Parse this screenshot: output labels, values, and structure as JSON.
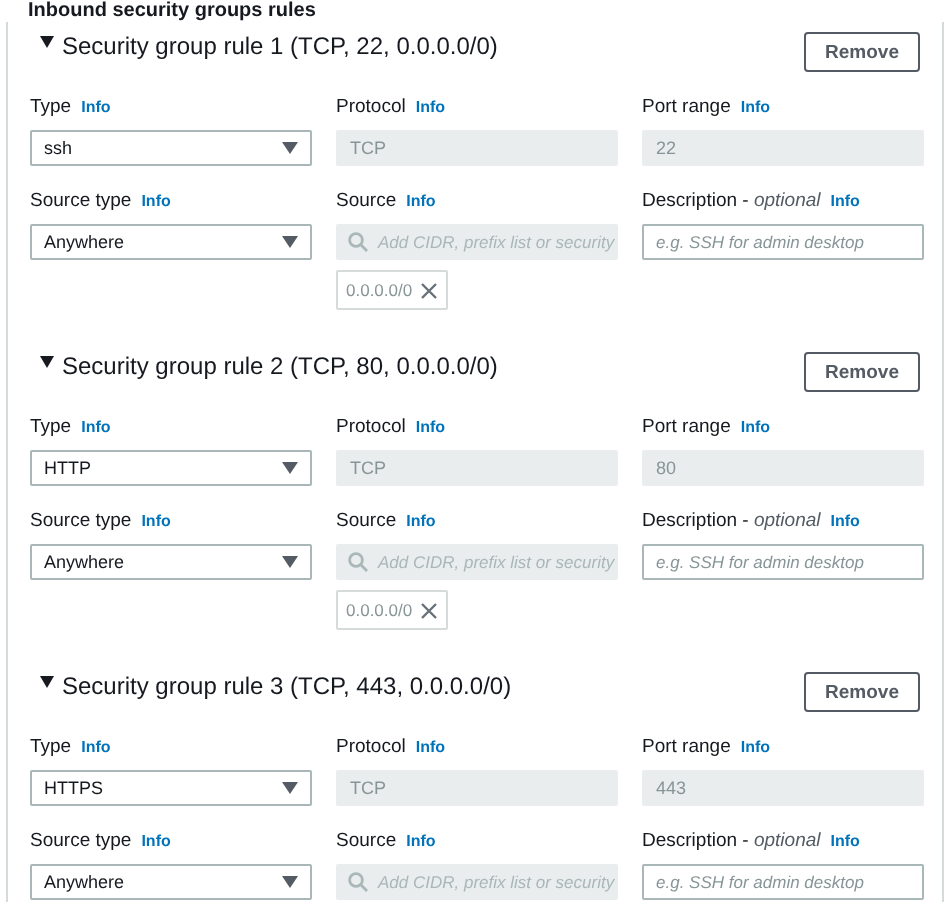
{
  "section_title": "Inbound security groups rules",
  "rules": [
    {
      "title": "Security group rule 1 (TCP, 22, 0.0.0.0/0)",
      "expanded": true,
      "remove_label": "Remove",
      "fields": [
        {
          "kind": "select",
          "label": "Type",
          "info": "Info",
          "value": "ssh",
          "disabled": false
        },
        {
          "kind": "text",
          "label": "Protocol",
          "info": "Info",
          "value": "TCP",
          "disabled": true
        },
        {
          "kind": "text",
          "label": "Port range",
          "info": "Info",
          "value": "22",
          "disabled": true
        },
        {
          "kind": "select",
          "label": "Source type",
          "info": "Info",
          "value": "Anywhere",
          "disabled": false
        },
        {
          "kind": "search",
          "label": "Source",
          "info": "Info",
          "placeholder": "Add CIDR, prefix list or security",
          "disabled": true,
          "tokens": [
            "0.0.0.0/0"
          ]
        },
        {
          "kind": "text",
          "label": "Description - *optional*",
          "info": "Info",
          "placeholder": "e.g. SSH for admin desktop",
          "disabled": false
        }
      ]
    },
    {
      "title": "Security group rule 2 (TCP, 80, 0.0.0.0/0)",
      "expanded": true,
      "remove_label": "Remove",
      "fields": [
        {
          "kind": "select",
          "label": "Type",
          "info": "Info",
          "value": "HTTP",
          "disabled": false
        },
        {
          "kind": "text",
          "label": "Protocol",
          "info": "Info",
          "value": "TCP",
          "disabled": true
        },
        {
          "kind": "text",
          "label": "Port range",
          "info": "Info",
          "value": "80",
          "disabled": true
        },
        {
          "kind": "select",
          "label": "Source type",
          "info": "Info",
          "value": "Anywhere",
          "disabled": false
        },
        {
          "kind": "search",
          "label": "Source",
          "info": "Info",
          "placeholder": "Add CIDR, prefix list or security",
          "disabled": true,
          "tokens": [
            "0.0.0.0/0"
          ]
        },
        {
          "kind": "text",
          "label": "Description - *optional*",
          "info": "Info",
          "placeholder": "e.g. SSH for admin desktop",
          "disabled": false
        }
      ]
    },
    {
      "title": "Security group rule 3 (TCP, 443, 0.0.0.0/0)",
      "expanded": true,
      "remove_label": "Remove",
      "fields": [
        {
          "kind": "select",
          "label": "Type",
          "info": "Info",
          "value": "HTTPS",
          "disabled": false
        },
        {
          "kind": "text",
          "label": "Protocol",
          "info": "Info",
          "value": "TCP",
          "disabled": true
        },
        {
          "kind": "text",
          "label": "Port range",
          "info": "Info",
          "value": "443",
          "disabled": true
        },
        {
          "kind": "select",
          "label": "Source type",
          "info": "Info",
          "value": "Anywhere",
          "disabled": false
        },
        {
          "kind": "search",
          "label": "Source",
          "info": "Info",
          "placeholder": "Add CIDR, prefix list or security",
          "disabled": true
        },
        {
          "kind": "text",
          "label": "Description - *optional*",
          "info": "Info",
          "placeholder": "e.g. SSH for admin desktop",
          "disabled": false
        }
      ]
    }
  ]
}
